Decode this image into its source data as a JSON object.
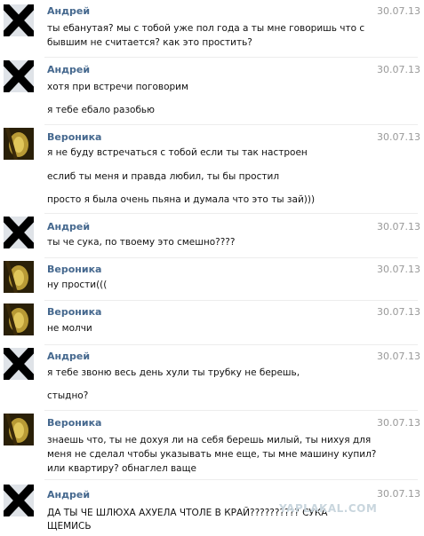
{
  "messages": [
    {
      "author": "Андрей",
      "date": "30.07.13",
      "lines": [
        "ты ебанутая? мы с тобой уже пол года а ты мне говоришь что с",
        "бывшим не считается? как это простить?"
      ]
    },
    {
      "author": "Андрей",
      "date": "30.07.13",
      "lines": [
        "хотя при встречи поговорим",
        "я тебе ебало разобью"
      ]
    },
    {
      "author": "Вероника",
      "date": "30.07.13",
      "lines": [
        "я не буду встречаться с тобой если ты так настроен",
        "еслиб ты меня и правда любил, ты бы простил",
        "просто я была очень пьяна и думала что это ты зай)))"
      ]
    },
    {
      "author": "Андрей",
      "date": "30.07.13",
      "lines": [
        "ты че сука, по твоему это смешно????"
      ]
    },
    {
      "author": "Вероника",
      "date": "30.07.13",
      "lines": [
        "ну прости((("
      ]
    },
    {
      "author": "Вероника",
      "date": "30.07.13",
      "lines": [
        "не молчи"
      ]
    },
    {
      "author": "Андрей",
      "date": "30.07.13",
      "lines": [
        "я тебе звоню весь день хули ты трубку не берешь,",
        "стыдно?"
      ]
    },
    {
      "author": "Вероника",
      "date": "30.07.13",
      "lines": [
        "знаешь что, ты не дохуя ли на себя берешь милый, ты нихуя для",
        "меня не сделал чтобы указывать мне еще, ты мне машину купил?",
        "или квартиру? обнаглел ваще"
      ]
    },
    {
      "author": "Андрей",
      "date": "30.07.13",
      "lines": [
        "ДА ТЫ ЧЕ ШЛЮХА АХУЕЛА ЧТОЛЕ В КРАЙ?????????? СУКА",
        "ЩЕМИСЬ"
      ]
    }
  ],
  "watermark": "YAPLAKAL.COM",
  "colors": {
    "author": "#45688e",
    "date": "#999999",
    "text": "#111111"
  },
  "avatar_types": {
    "Андрей": "crossed-out-avatar",
    "Вероника": "photo-avatar"
  }
}
